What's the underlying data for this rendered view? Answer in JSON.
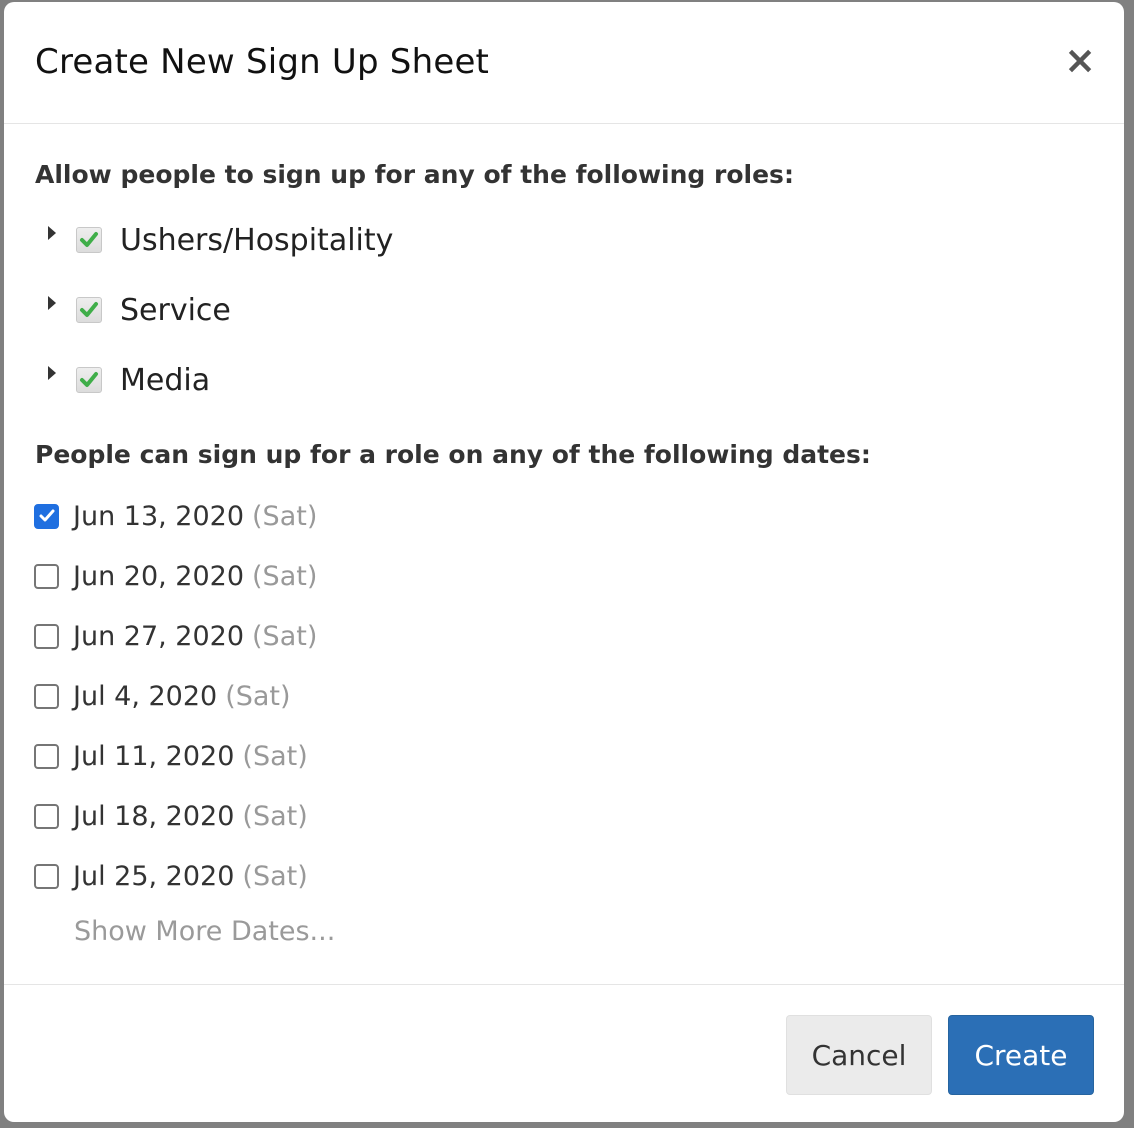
{
  "modal": {
    "title": "Create New Sign Up Sheet",
    "close_label": "×"
  },
  "roles_section": {
    "label": "Allow people to sign up for any of the following roles:",
    "roles": [
      {
        "label": "Ushers/Hospitality",
        "checked": true
      },
      {
        "label": "Service",
        "checked": true
      },
      {
        "label": "Media",
        "checked": true
      }
    ]
  },
  "dates_section": {
    "label": "People can sign up for a role on any of the following dates:",
    "dates": [
      {
        "date": "Jun 13, 2020",
        "day": "(Sat)",
        "checked": true
      },
      {
        "date": "Jun 20, 2020",
        "day": "(Sat)",
        "checked": false
      },
      {
        "date": "Jun 27, 2020",
        "day": "(Sat)",
        "checked": false
      },
      {
        "date": "Jul 4, 2020",
        "day": "(Sat)",
        "checked": false
      },
      {
        "date": "Jul 11, 2020",
        "day": "(Sat)",
        "checked": false
      },
      {
        "date": "Jul 18, 2020",
        "day": "(Sat)",
        "checked": false
      },
      {
        "date": "Jul 25, 2020",
        "day": "(Sat)",
        "checked": false
      }
    ],
    "show_more_label": "Show More Dates..."
  },
  "footer": {
    "cancel_label": "Cancel",
    "create_label": "Create"
  },
  "colors": {
    "primary_button": "#2b6fb6",
    "checkbox_checked": "#1f6fe0",
    "role_checkmark": "#3fae49",
    "overlay": "#808080"
  },
  "icons": {
    "close": "close-icon",
    "expand": "caret-right-icon",
    "role_check": "checkmark-icon"
  }
}
